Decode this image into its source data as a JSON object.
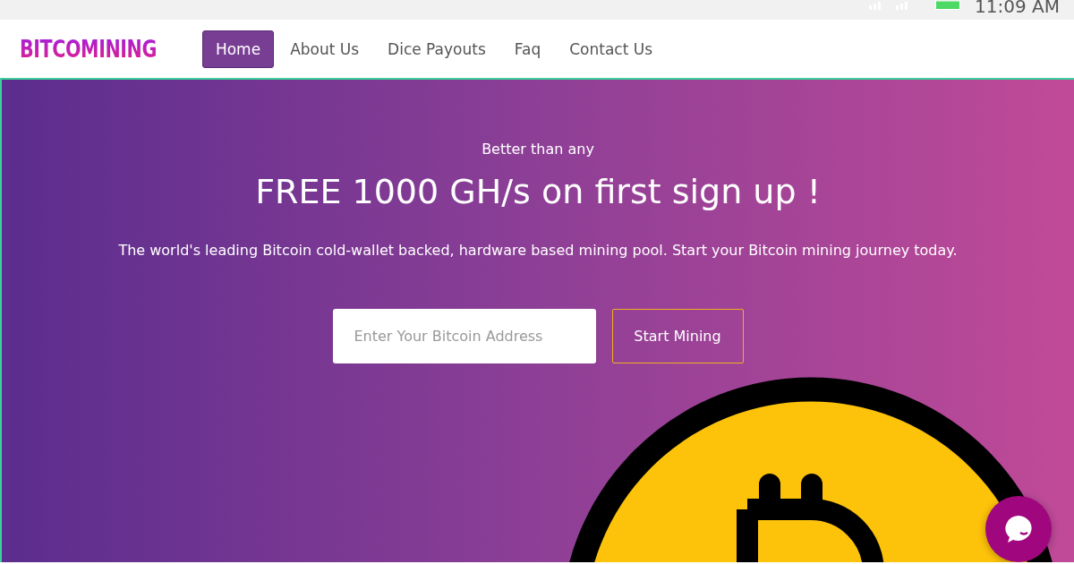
{
  "status_bar": {
    "time": "11:09 AM"
  },
  "nav": {
    "logo": "BITCOMINING",
    "items": [
      {
        "label": "Home",
        "selected": true
      },
      {
        "label": "About Us",
        "selected": false
      },
      {
        "label": "Dice Payouts",
        "selected": false
      },
      {
        "label": "Faq",
        "selected": false
      },
      {
        "label": "Contact Us",
        "selected": false
      }
    ]
  },
  "hero": {
    "eyebrow": "Better than any",
    "headline": "FREE 1000 GH/s on first sign up !",
    "subtitle": "The world's leading Bitcoin cold-wallet backed, hardware based mining pool. Start your Bitcoin mining journey today.",
    "address_field": {
      "placeholder": "Enter Your Bitcoin Address"
    },
    "button": "Start Mining"
  }
}
